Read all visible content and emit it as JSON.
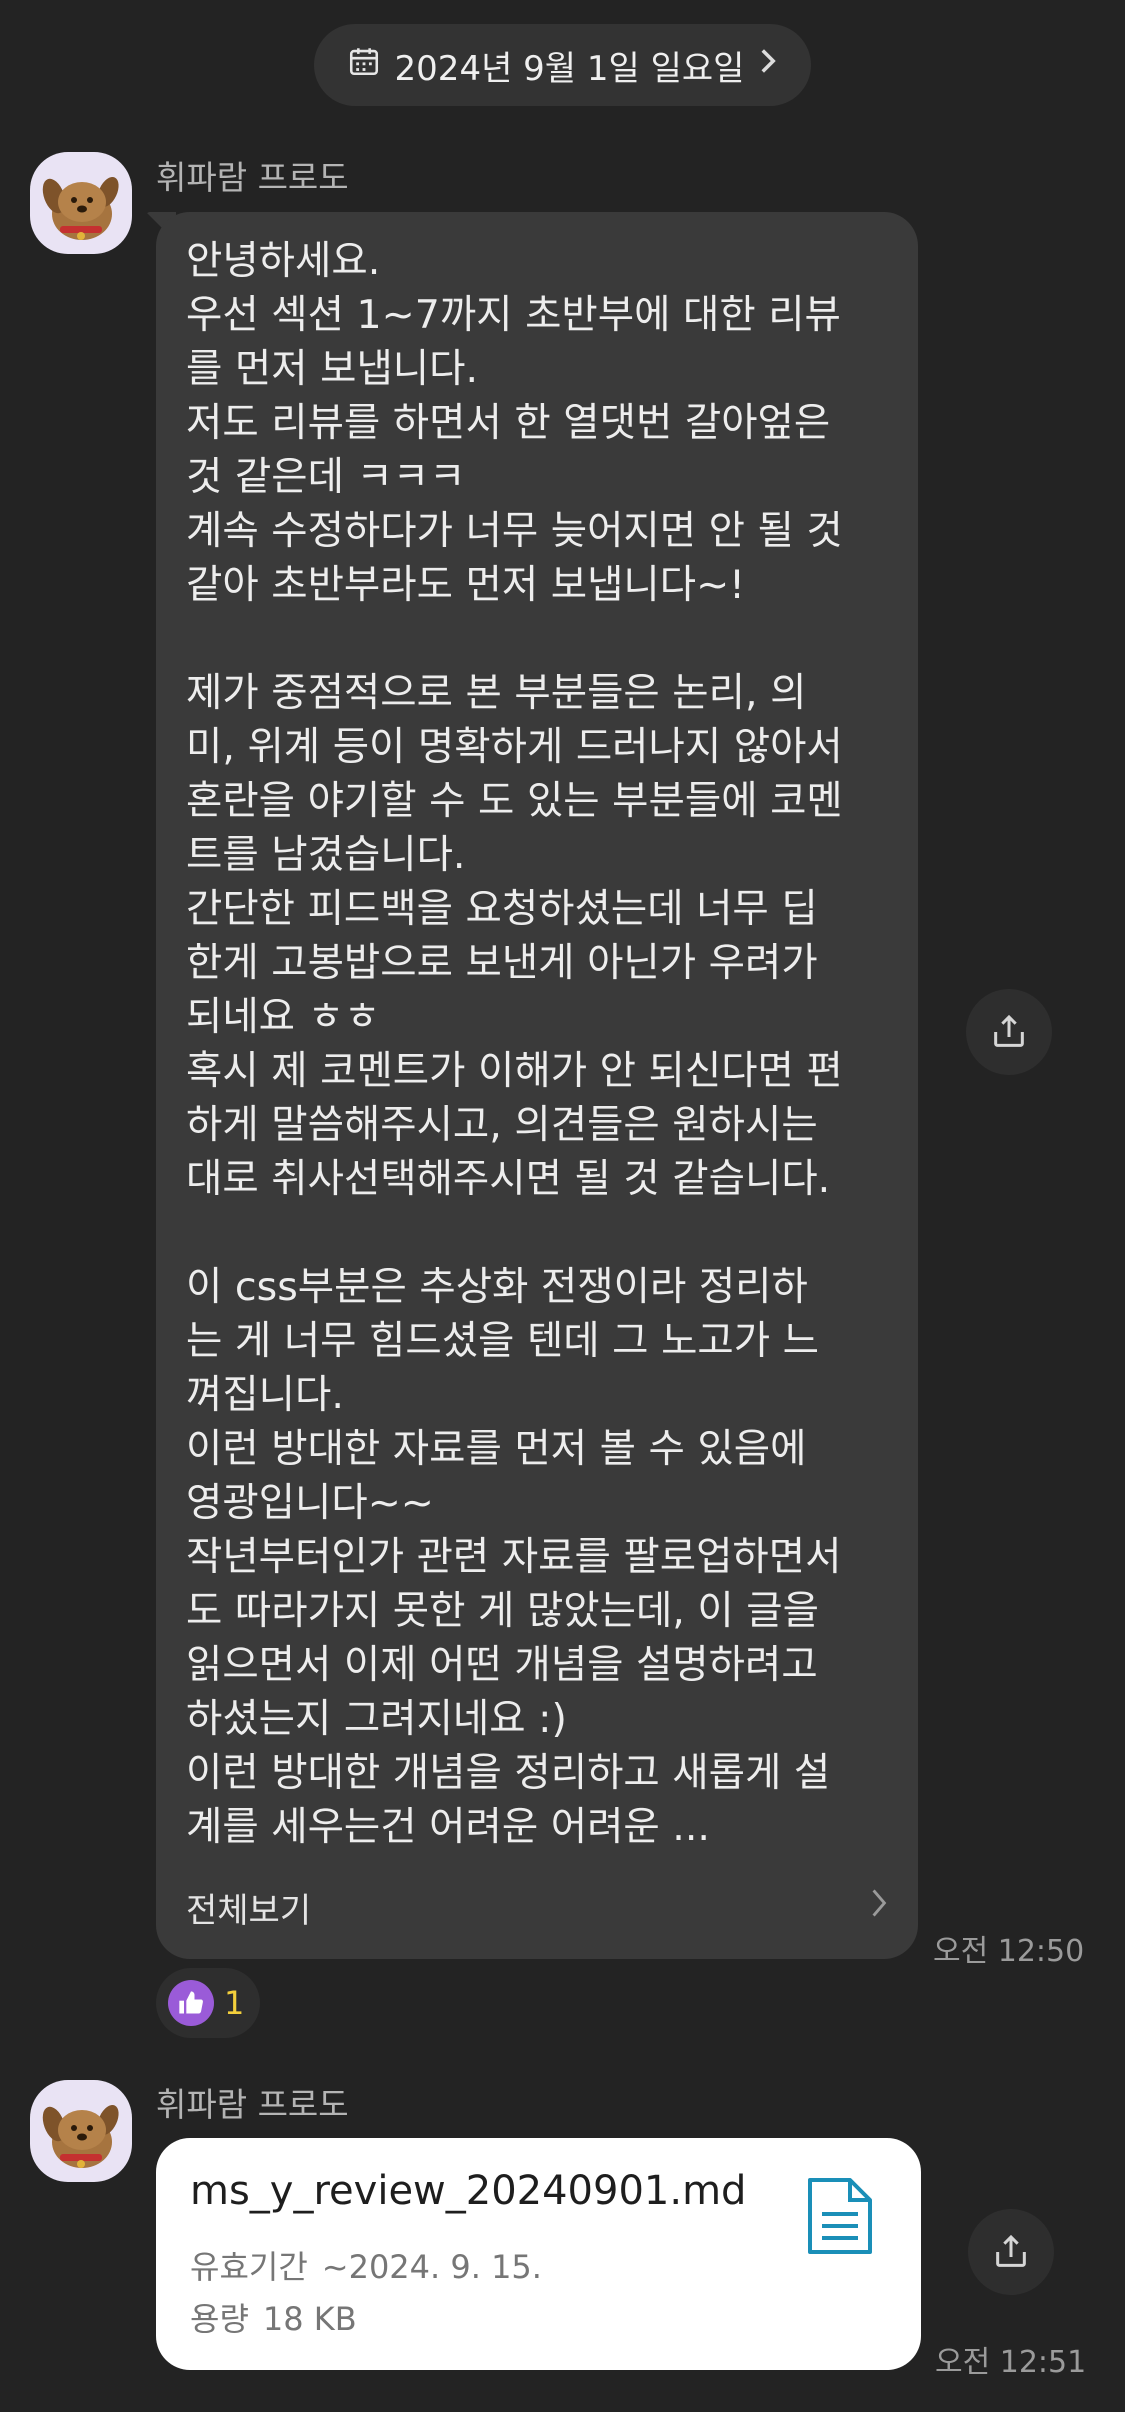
{
  "date_header": {
    "label": "2024년 9월 1일 일요일"
  },
  "messages": [
    {
      "sender": "휘파람 프로도",
      "text": "안녕하세요.\n우선 섹션 1~7까지 초반부에 대한 리뷰\n를 먼저 보냅니다.\n저도 리뷰를 하면서 한 열댓번 갈아엎은\n것 같은데 ㅋㅋㅋ\n계속 수정하다가 너무 늦어지면 안 될 것\n같아 초반부라도 먼저 보냅니다~!\n\n제가 중점적으로 본 부분들은 논리, 의\n미, 위계 등이 명확하게 드러나지 않아서\n혼란을 야기할 수 도 있는 부분들에 코멘\n트를 남겼습니다.\n간단한 피드백을 요청하셨는데 너무 딥\n한게 고봉밥으로 보낸게 아닌가 우려가\n되네요 ㅎㅎ\n혹시 제 코멘트가 이해가 안 되신다면 편\n하게 말씀해주시고, 의견들은 원하시는\n대로 취사선택해주시면 될 것 같습니다.\n\n이 css부분은 추상화 전쟁이라 정리하\n는 게 너무 힘드셨을 텐데 그 노고가 느\n껴집니다.\n이런 방대한 자료를 먼저 볼 수 있음에\n영광입니다~~\n작년부터인가 관련 자료를 팔로업하면서\n도 따라가지 못한 게 많았는데, 이 글을\n읽으면서 이제 어떤 개념을 설명하려고\n하셨는지 그려지네요 :)\n이런 방대한 개념을 정리하고 새롭게 설\n계를 세우는건 어려운 어려운 ...",
      "more_label": "전체보기",
      "time": "오전 12:50",
      "reaction": {
        "icon": "thumbs-up-icon",
        "count": "1"
      }
    },
    {
      "sender": "휘파람 프로도",
      "file": {
        "name": "ms_y_review_20240901.md",
        "expiry_label": "유효기간",
        "expiry_value": "~2024. 9. 15.",
        "size_label": "용량",
        "size_value": "18 KB",
        "icon": "document-icon"
      },
      "time": "오전 12:51"
    }
  ],
  "colors": {
    "background": "#232323",
    "bubble": "#3a3a3a",
    "file_card": "#ffffff",
    "file_icon": "#1a8fb8",
    "reaction_badge": "#9a5bd8",
    "reaction_count": "#f3cf3c"
  }
}
